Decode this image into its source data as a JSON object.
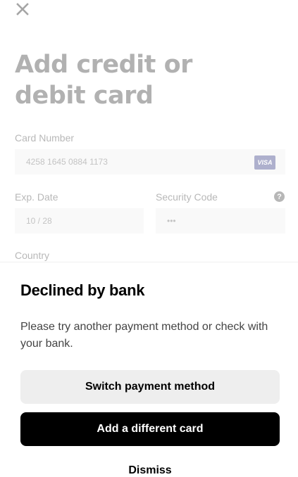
{
  "form": {
    "title": "Add credit or debit card",
    "card_number_label": "Card Number",
    "card_number_value": "4258 1645 0884 1173",
    "card_brand": "VISA",
    "exp_label": "Exp. Date",
    "exp_value": "10 / 28",
    "security_label": "Security Code",
    "security_value": "•••",
    "country_label": "Country",
    "help_glyph": "?"
  },
  "dialog": {
    "title": "Declined by bank",
    "message": "Please try another payment method or check with your bank.",
    "switch_label": "Switch payment method",
    "add_label": "Add a different card",
    "dismiss_label": "Dismiss"
  },
  "colors": {
    "primary_button": "#000000",
    "secondary_button": "#eeeeee",
    "visa_brand": "#1a1f71"
  },
  "icons": {
    "close": "close-icon",
    "help": "help-icon"
  }
}
